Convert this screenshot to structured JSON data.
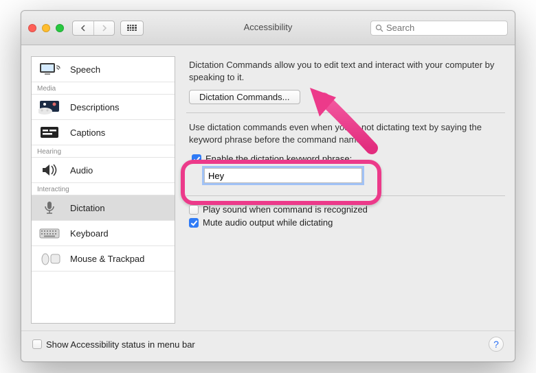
{
  "window": {
    "title": "Accessibility",
    "search_placeholder": "Search"
  },
  "sidebar": {
    "groups": [
      {
        "items": [
          {
            "label": "Speech",
            "icon": "speech-icon"
          }
        ]
      },
      {
        "label": "Media",
        "items": [
          {
            "label": "Descriptions",
            "icon": "descriptions-icon"
          },
          {
            "label": "Captions",
            "icon": "captions-icon"
          }
        ]
      },
      {
        "label": "Hearing",
        "items": [
          {
            "label": "Audio",
            "icon": "audio-icon"
          }
        ]
      },
      {
        "label": "Interacting",
        "items": [
          {
            "label": "Dictation",
            "icon": "dictation-icon",
            "selected": true
          },
          {
            "label": "Keyboard",
            "icon": "keyboard-icon"
          },
          {
            "label": "Mouse & Trackpad",
            "icon": "mouse-icon"
          }
        ]
      }
    ]
  },
  "main": {
    "section1_desc": "Dictation Commands allow you to edit text and interact with your computer by speaking to it.",
    "commands_button": "Dictation Commands...",
    "section2_desc": "Use dictation commands even when you're not dictating text by saying the keyword phrase before the command name.",
    "enable_keyword_label": "Enable the dictation keyword phrase:",
    "enable_keyword_checked": true,
    "keyword_value": "Hey",
    "play_sound_label": "Play sound when command is recognized",
    "play_sound_checked": false,
    "mute_audio_label": "Mute audio output while dictating",
    "mute_audio_checked": true
  },
  "footer": {
    "show_status_label": "Show Accessibility status in menu bar",
    "show_status_checked": false
  },
  "annotation": {
    "color": "#ec3a8a"
  }
}
